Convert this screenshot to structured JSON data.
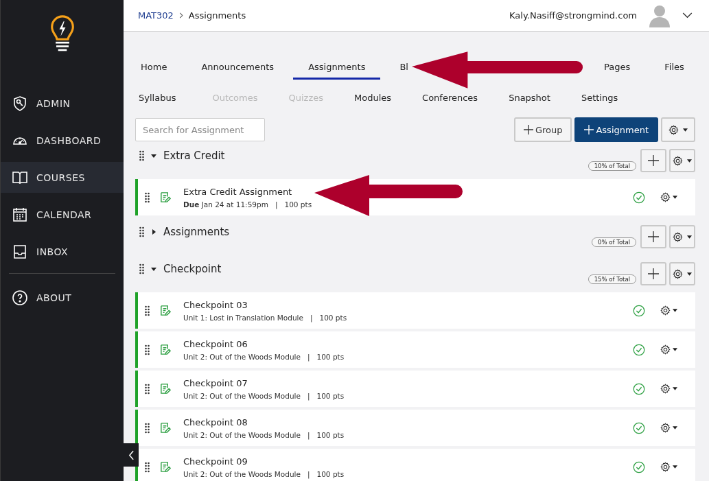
{
  "sidebar": {
    "items": [
      {
        "label": "ADMIN",
        "selected": false
      },
      {
        "label": "DASHBOARD",
        "selected": false
      },
      {
        "label": "COURSES",
        "selected": true
      },
      {
        "label": "CALENDAR",
        "selected": false
      },
      {
        "label": "INBOX",
        "selected": false
      },
      {
        "label": "ABOUT",
        "selected": false
      }
    ]
  },
  "breadcrumb": {
    "course": "MAT302",
    "page": "Assignments"
  },
  "user": {
    "email": "Kaly.Nasiff@strongmind.com"
  },
  "tabs": [
    [
      {
        "label": "Home",
        "selected": false,
        "disabled": false
      },
      {
        "label": "Announcements",
        "selected": false,
        "disabled": false
      },
      {
        "label": "Assignments",
        "selected": true,
        "disabled": false
      },
      {
        "label": "Bl",
        "selected": false,
        "disabled": false
      },
      {
        "label": "Pages",
        "selected": false,
        "disabled": false
      },
      {
        "label": "Files",
        "selected": false,
        "disabled": false
      }
    ],
    [
      {
        "label": "Syllabus",
        "selected": false,
        "disabled": false
      },
      {
        "label": "Outcomes",
        "selected": false,
        "disabled": true
      },
      {
        "label": "Quizzes",
        "selected": false,
        "disabled": true
      },
      {
        "label": "Modules",
        "selected": false,
        "disabled": false
      },
      {
        "label": "Conferences",
        "selected": false,
        "disabled": false
      },
      {
        "label": "Snapshot",
        "selected": false,
        "disabled": false
      },
      {
        "label": "Settings",
        "selected": false,
        "disabled": false
      }
    ]
  ],
  "search": {
    "placeholder": "Search for Assignment"
  },
  "buttons": {
    "group": "Group",
    "assignment": "Assignment"
  },
  "groups": [
    {
      "name": "Extra Credit",
      "expanded": true,
      "weight": "10% of Total",
      "items": [
        {
          "title": "Extra Credit Assignment",
          "detail": "**Due** Jan 24 at 11:59pm   |   100 pts",
          "published": true
        }
      ]
    },
    {
      "name": "Assignments",
      "expanded": false,
      "weight": "0% of Total"
    },
    {
      "name": "Checkpoint",
      "expanded": true,
      "weight": "15% of Total",
      "items": [
        {
          "title": "Checkpoint 03",
          "detail": "Unit 1: Lost in Translation Module   |   100 pts",
          "published": true
        },
        {
          "title": "Checkpoint 06",
          "detail": "Unit 2: Out of the Woods Module   |   100 pts",
          "published": true
        },
        {
          "title": "Checkpoint 07",
          "detail": "Unit 2: Out of the Woods Module   |   100 pts",
          "published": true
        },
        {
          "title": "Checkpoint 08",
          "detail": "Unit 2: Out of the Woods Module   |   100 pts",
          "published": true
        },
        {
          "title": "Checkpoint 09",
          "detail": "Unit 2: Out of the Woods Module   |   100 pts",
          "published": true
        }
      ]
    }
  ]
}
